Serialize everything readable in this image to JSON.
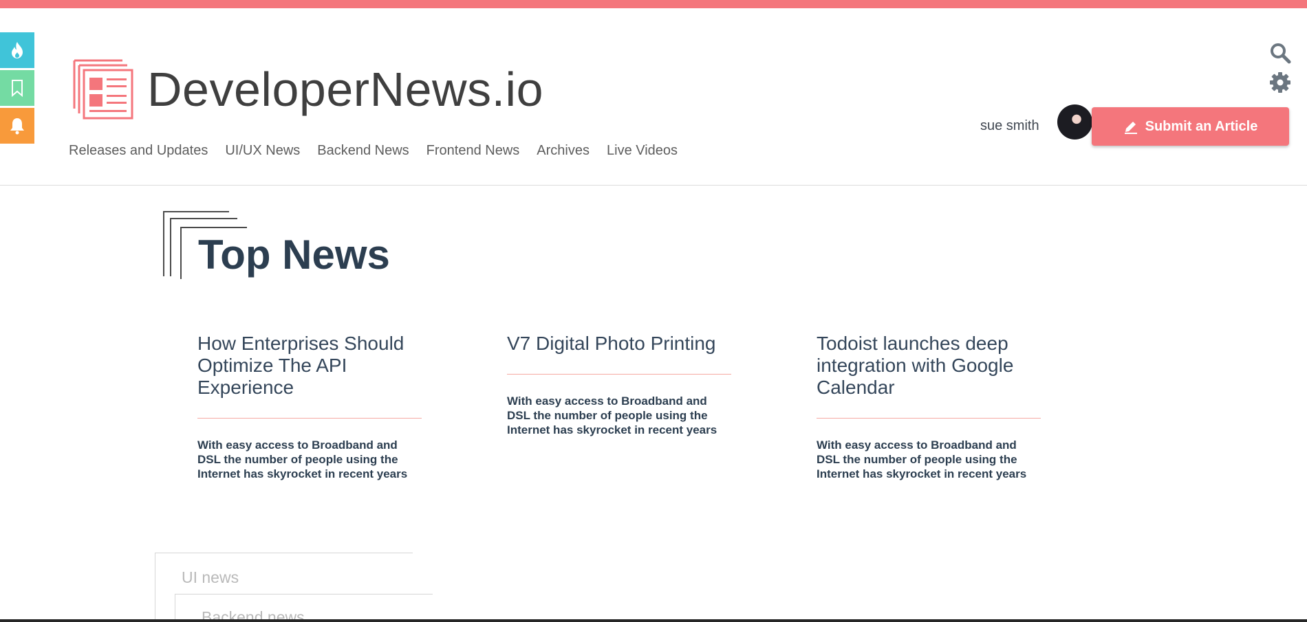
{
  "brand": {
    "name": "DeveloperNews.io",
    "accent": "#f4767c"
  },
  "side_actions": [
    {
      "icon": "flame-icon",
      "color": "#40c4d9"
    },
    {
      "icon": "bookmark-icon",
      "color": "#74dba3"
    },
    {
      "icon": "bell-icon",
      "color": "#f89a3b"
    }
  ],
  "nav": [
    {
      "label": "Releases and Updates"
    },
    {
      "label": "UI/UX News"
    },
    {
      "label": "Backend News"
    },
    {
      "label": "Frontend News"
    },
    {
      "label": "Archives"
    },
    {
      "label": "Live Videos"
    }
  ],
  "toolbar": {
    "search_icon": "search-icon",
    "settings_icon": "gear-icon"
  },
  "user": {
    "name": "sue smith"
  },
  "submit": {
    "label": "Submit an Article",
    "icon": "pencil-icon"
  },
  "section": {
    "title": "Top News"
  },
  "articles": [
    {
      "title": "How Enterprises Should Optimize The API Experience",
      "summary": "With easy access to Broadband and DSL the number of people using the Internet has skyrocket in recent years"
    },
    {
      "title": "V7 Digital Photo Printing",
      "summary": "With easy access to Broadband and DSL the number of people using the Internet has skyrocket in recent years"
    },
    {
      "title": "Todoist launches deep integration with Google Calendar",
      "summary": "With easy access to Broadband and DSL the number of people using the Internet has skyrocket in recent years"
    }
  ],
  "stacked_cards": [
    {
      "label": "UI news"
    },
    {
      "label": "Backend news"
    }
  ]
}
